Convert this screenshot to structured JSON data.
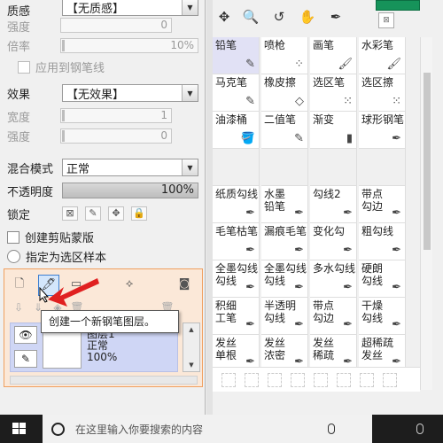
{
  "brush_props": {
    "texture": {
      "label": "质感",
      "value": "【无质感】"
    },
    "strength": {
      "label": "强度",
      "value": "0"
    },
    "scale": {
      "label": "倍率",
      "value": "10%"
    },
    "apply_to_pen": "应用到钢笔线",
    "effect": {
      "label": "效果",
      "value": "【无效果】"
    },
    "width": {
      "label": "宽度",
      "value": "1"
    },
    "strength2": {
      "label": "强度",
      "value": "0"
    }
  },
  "layer_props": {
    "blend": {
      "label": "混合模式",
      "value": "正常"
    },
    "opacity": {
      "label": "不透明度",
      "value": "100%"
    },
    "lock": {
      "label": "锁定"
    },
    "clip_group": "创建剪贴蒙版",
    "selection_source": "指定为选区样本"
  },
  "tooltip": "创建一个新钢笔图层。",
  "layer": {
    "name": "图层1",
    "mode": "正常",
    "opacity": "100%"
  },
  "brushes": [
    "铅笔",
    "喷枪",
    "画笔",
    "水彩笔",
    "马克笔",
    "橡皮擦",
    "选区笔",
    "选区擦",
    "油漆桶",
    "二值笔",
    "渐变",
    "球形钢笔",
    "",
    "",
    "",
    "",
    "纸质勾线",
    "水墨\n铅笔",
    "勾线2",
    "带点\n勾边",
    "毛笔枯笔",
    "漏痕毛笔",
    "变化勾",
    "粗勾线",
    "全墨勾线\n勾线",
    "全墨勾线\n勾线",
    "多水勾线",
    "硬朗\n勾线",
    "积细\n工笔",
    "半透明\n勾线",
    "带点\n勾边",
    "干燥\n勾线",
    "发丝\n单根",
    "发丝\n浓密",
    "发丝\n稀疏",
    "超稀疏\n发丝"
  ],
  "taskbar": {
    "search_placeholder": "在这里输入你要搜索的内容"
  },
  "colors": {
    "main_color": "#16935a",
    "selection_highlight": "#3d7fd1",
    "tooltip_arrow": "#e02020"
  }
}
